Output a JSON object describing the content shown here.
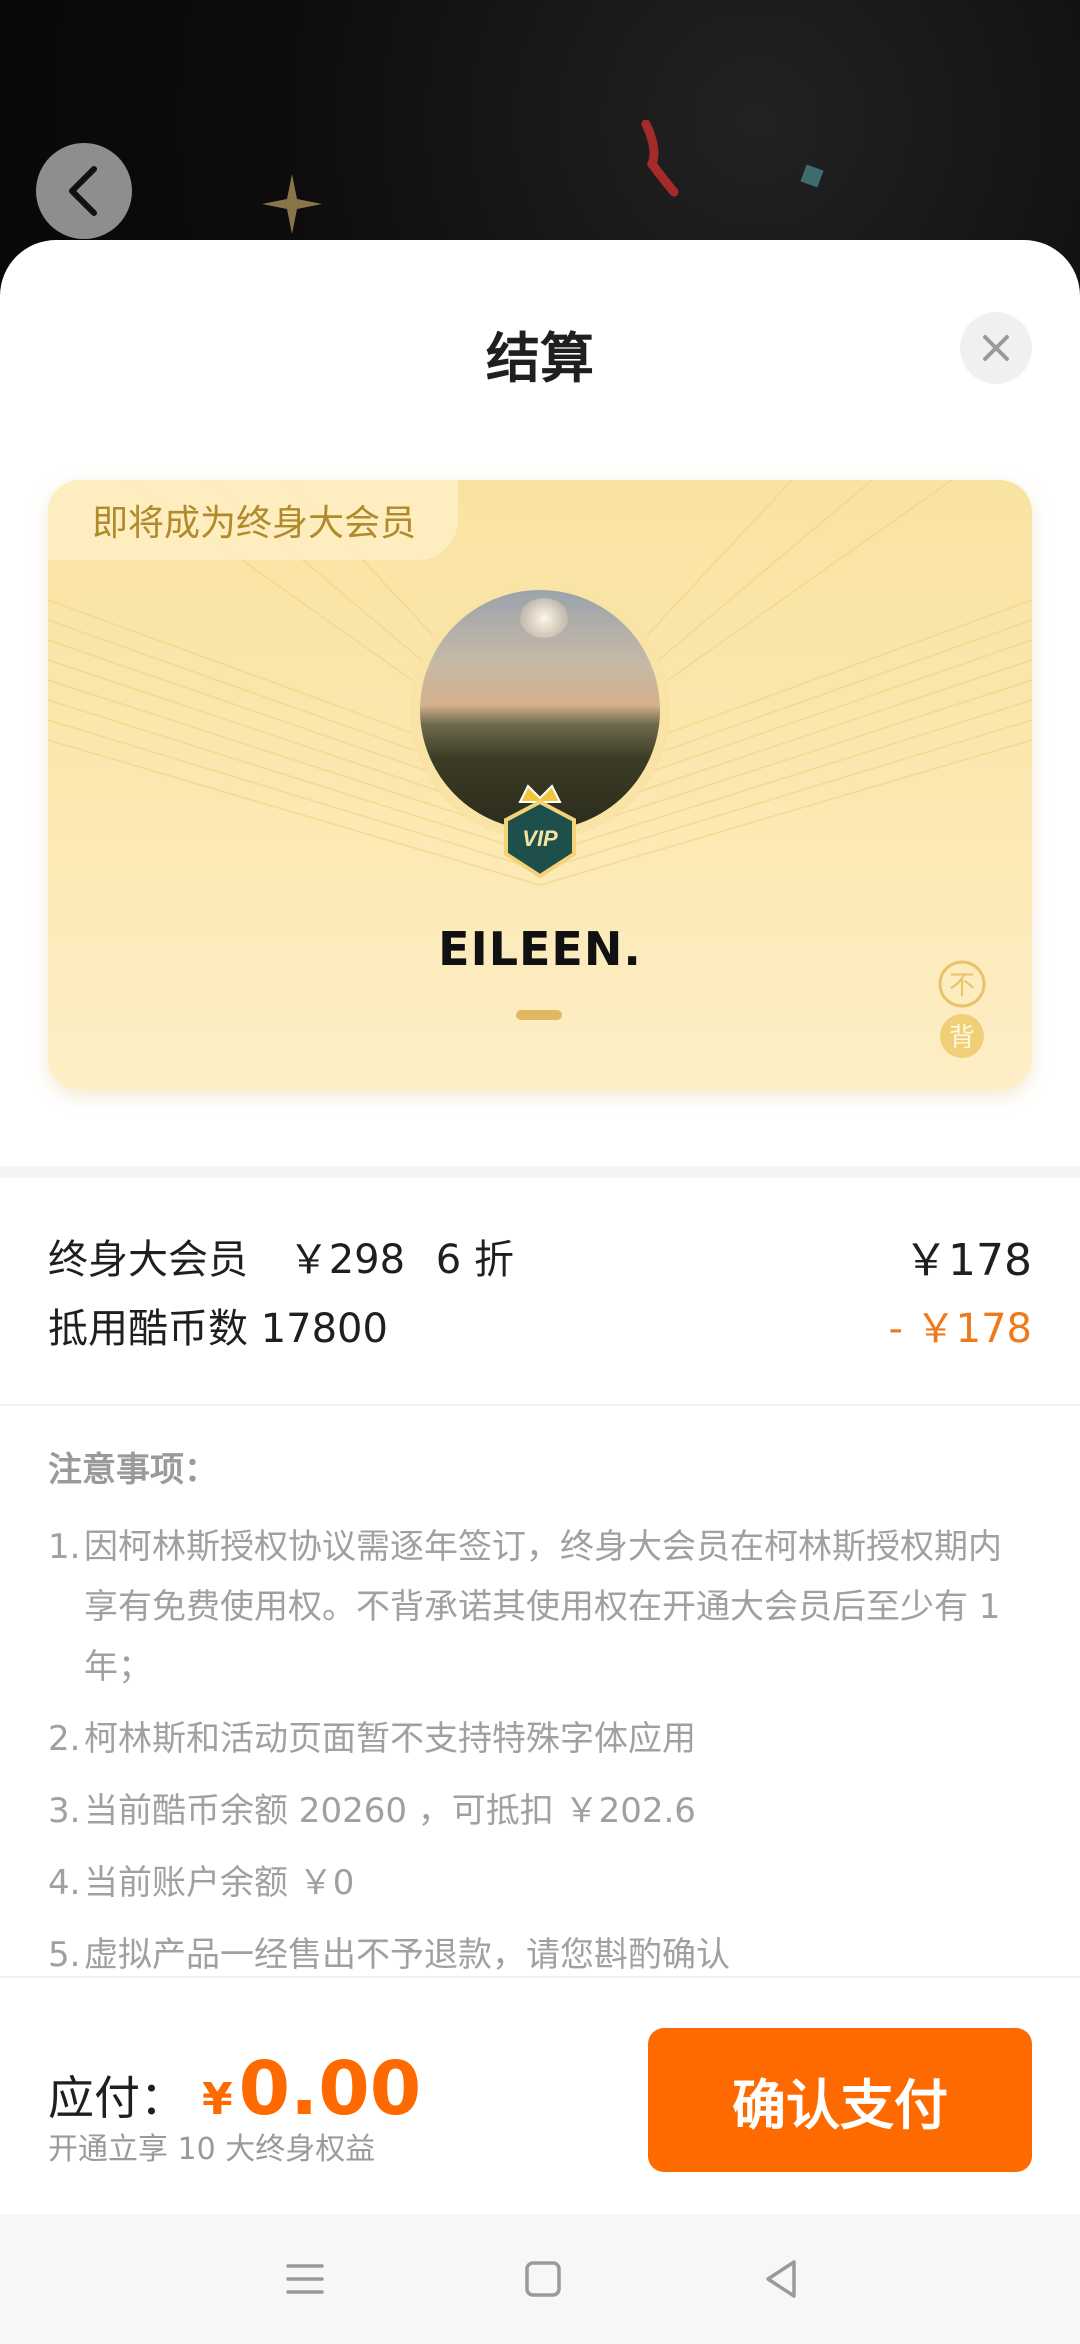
{
  "sheet": {
    "title": "结算"
  },
  "card": {
    "tag": "即将成为终身大会员",
    "username": "EILEEN.",
    "vip_badge_text": "VIP",
    "seal_text": [
      "不",
      "背"
    ]
  },
  "pricing": {
    "row1_label": "终身大会员",
    "row1_original": "￥298",
    "row1_discount": "6 折",
    "row1_amount": "￥178",
    "row2_label": "抵用酷币数 17800",
    "row2_amount": "- ￥178"
  },
  "notes": {
    "title": "注意事项：",
    "items": [
      {
        "num": "1.",
        "text": "因柯林斯授权协议需逐年签订，终身大会员在柯林斯授权期内享有免费使用权。不背承诺其使用权在开通大会员后至少有 1 年；"
      },
      {
        "num": "2.",
        "text": "柯林斯和活动页面暂不支持特殊字体应用"
      },
      {
        "num": "3.",
        "text": "当前酷币余额 20260 ，可抵扣 ￥202.6"
      },
      {
        "num": "4.",
        "text": "当前账户余额 ￥0"
      },
      {
        "num": "5.",
        "text": "虚拟产品一经售出不予退款，请您斟酌确认"
      }
    ]
  },
  "pay": {
    "label": "应付：",
    "currency": "¥",
    "amount": "0.00",
    "subtitle": "开通立享 10 大终身权益",
    "confirm_label": "确认支付"
  },
  "colors": {
    "accent": "#ff6a00",
    "deduct": "#ef7a1c",
    "card_gold": "#f9e3a2"
  },
  "icons": {
    "back": "chevron-left-icon",
    "close": "close-icon",
    "menu": "menu-icon",
    "home": "square-home-icon",
    "nav_back": "triangle-back-icon"
  }
}
